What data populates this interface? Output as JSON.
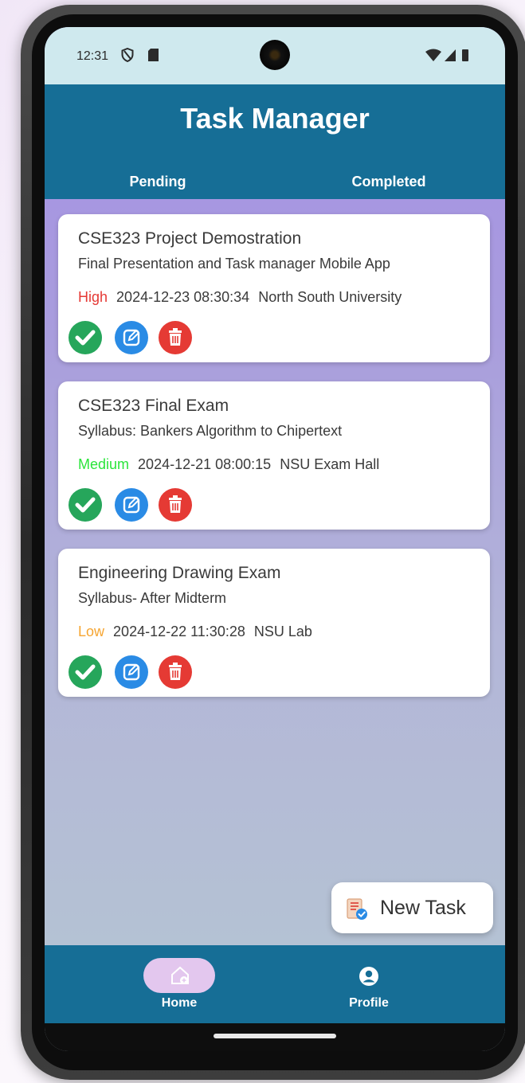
{
  "status_bar": {
    "time": "12:31"
  },
  "app": {
    "title": "Task Manager"
  },
  "tabs": [
    {
      "label": "Pending"
    },
    {
      "label": "Completed"
    }
  ],
  "tasks": [
    {
      "title": "CSE323 Project Demostration",
      "description": "Final Presentation and Task manager Mobile App",
      "priority": "High",
      "datetime": "2024-12-23 08:30:34",
      "location": "North South University"
    },
    {
      "title": "CSE323 Final Exam",
      "description": "Syllabus: Bankers Algorithm to Chipertext",
      "priority": "Medium",
      "datetime": "2024-12-21 08:00:15",
      "location": "NSU Exam Hall"
    },
    {
      "title": "Engineering Drawing Exam",
      "description": "Syllabus- After Midterm",
      "priority": "Low",
      "datetime": "2024-12-22 11:30:28",
      "location": "NSU Lab"
    }
  ],
  "fab": {
    "label": "New Task"
  },
  "bottom_nav": [
    {
      "label": "Home"
    },
    {
      "label": "Profile"
    }
  ],
  "colors": {
    "primary": "#166e96",
    "priority_high": "#e53935",
    "priority_medium": "#2be53b",
    "priority_low": "#f6a531",
    "done_button": "#26a65b",
    "edit_button": "#2a8be5",
    "delete_button": "#e53a34"
  },
  "icons": {
    "done": "check-circle-icon",
    "edit": "edit-square-icon",
    "delete": "trash-icon",
    "fab": "task-list-icon",
    "home": "home-add-icon",
    "profile": "account-circle-icon"
  }
}
